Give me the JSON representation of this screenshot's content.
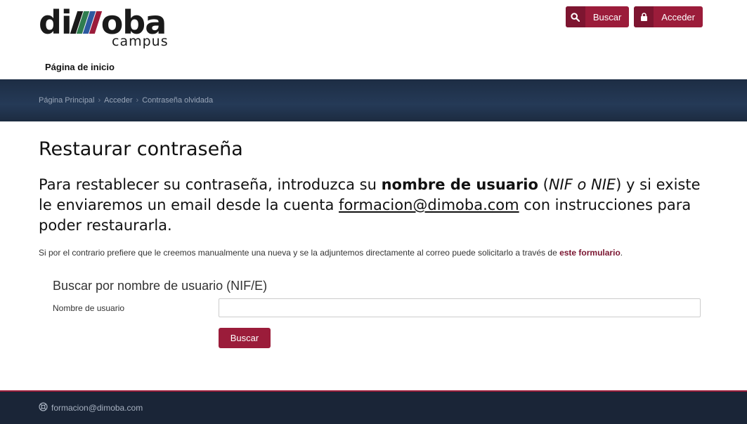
{
  "header": {
    "logo": {
      "word_left": "di",
      "word_right": "oba",
      "sub": "campus",
      "bar_colors": [
        "#1a1a1a",
        "#2f7d4f",
        "#2d5aa0",
        "#9b1c3a"
      ]
    },
    "search_button": {
      "label": "Buscar",
      "icon": "search-icon"
    },
    "login_button": {
      "label": "Acceder",
      "icon": "lock-icon"
    },
    "nav_home": "Página de inicio",
    "accent": "#9b1c3a"
  },
  "breadcrumb": {
    "items": [
      "Página Principal",
      "Acceder",
      "Contraseña olvidada"
    ]
  },
  "main": {
    "title": "Restaurar contraseña",
    "intro": {
      "p1": "Para restablecer su contraseña, introduzca su ",
      "bold": "nombre de usuario",
      "p2": " (",
      "italic": "NIF o NIE",
      "p3": ") y si existe le enviaremos un email desde la cuenta ",
      "email": "formacion@dimoba.com",
      "p4": " con instrucciones para poder restaurarla."
    },
    "note": {
      "text": "Si por el contrario prefiere que le creemos manualmente una nueva y se la adjuntemos directamente al correo puede solicitarlo a través de ",
      "link": "este formulario",
      "end": "."
    },
    "form": {
      "title": "Buscar por nombre de usuario (NIF/E)",
      "username_label": "Nombre de usuario",
      "username_value": "",
      "submit_label": "Buscar"
    }
  },
  "footer": {
    "email": "formacion@dimoba.com",
    "icon": "lifebuoy-icon"
  }
}
